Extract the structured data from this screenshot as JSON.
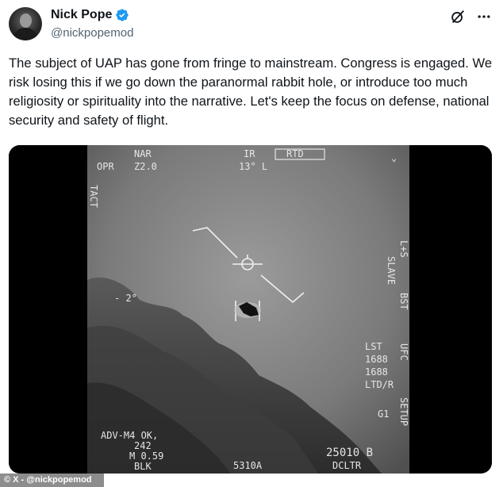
{
  "author": {
    "name": "Nick Pope",
    "handle": "@nickpopemod",
    "verified": true,
    "avatar_icon": "user-avatar"
  },
  "tweet": {
    "text": "The subject of UAP has gone from fringe to mainstream. Congress is engaged. We risk losing this if we go down the paranormal rabbit hole, or introduce too much religiosity or spirituality into the narrative. Let's keep the focus on defense, national security and safety of flight."
  },
  "icons": {
    "grok": "grok-icon",
    "more": "more-icon",
    "verified": "verified-badge-icon"
  },
  "colors": {
    "verified_blue": "#1d9bf0",
    "text_primary": "#0f1419",
    "text_secondary": "#536471"
  },
  "media": {
    "hud": {
      "top_left_1": "NAR",
      "top_left_2": "OPR",
      "top_left_3": "Z2.0",
      "top_center_1": "IR",
      "top_center_2": "13° L",
      "rtd_box": "RTD",
      "left_vertical": "TACT",
      "angle_left": "- 2°",
      "right_vertical_1": "L+S",
      "right_vertical_2": "SLAVE",
      "right_vertical_3": "BST",
      "lst": "LST",
      "val_1": "1688",
      "val_2": "1688",
      "ltd": "LTD/R",
      "ufc": "UFC",
      "setup": "SETUP",
      "g1": "G1",
      "bottom_left_1": "ADV-M4 OK,",
      "bottom_left_2": "242",
      "bottom_left_3": "M 0.59",
      "bottom_left_4": "BLK",
      "bottom_center": "5310A",
      "bottom_right_1": "25010 B",
      "bottom_right_2": "DCLTR"
    }
  },
  "watermark": "© X - @nickpopemod"
}
